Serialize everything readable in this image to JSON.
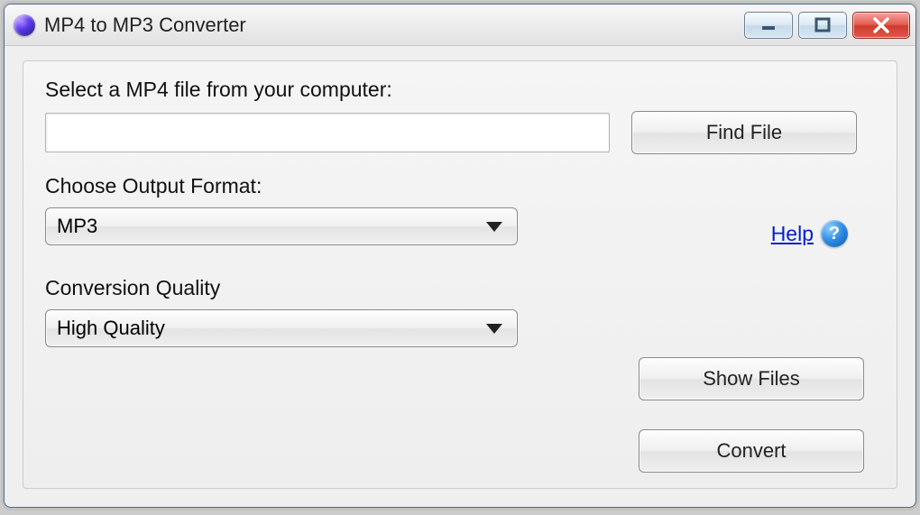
{
  "window": {
    "title": "MP4 to MP3 Converter"
  },
  "labels": {
    "select_file": "Select a MP4 file from your computer:",
    "output_format": "Choose Output Format:",
    "quality": "Conversion Quality"
  },
  "inputs": {
    "file_value": "",
    "file_placeholder": ""
  },
  "selects": {
    "format_value": "MP3",
    "quality_value": "High Quality"
  },
  "buttons": {
    "find_file": "Find File",
    "show_files": "Show Files",
    "convert": "Convert"
  },
  "help": {
    "link_text": "Help",
    "icon_glyph": "?"
  }
}
